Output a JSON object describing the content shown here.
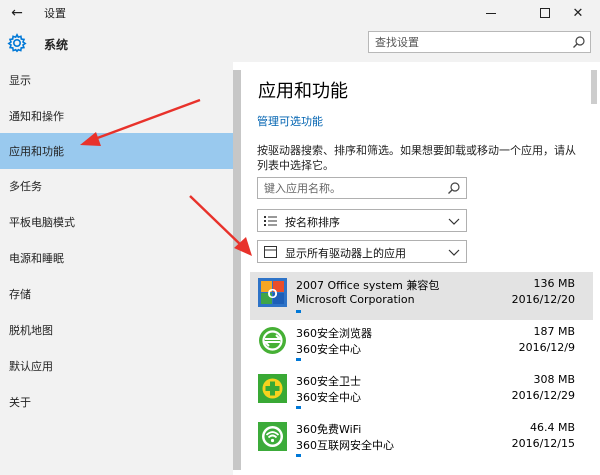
{
  "window": {
    "back_glyph": "←",
    "title": "设置",
    "minimize_icon": "minimize-icon",
    "maximize_icon": "maximize-icon",
    "close_glyph": "✕"
  },
  "header": {
    "section_title": "系统",
    "search_placeholder": "查找设置"
  },
  "sidebar": {
    "items": [
      {
        "label": "显示",
        "active": false
      },
      {
        "label": "通知和操作",
        "active": false
      },
      {
        "label": "应用和功能",
        "active": true
      },
      {
        "label": "多任务",
        "active": false
      },
      {
        "label": "平板电脑模式",
        "active": false
      },
      {
        "label": "电源和睡眠",
        "active": false
      },
      {
        "label": "存储",
        "active": false
      },
      {
        "label": "脱机地图",
        "active": false
      },
      {
        "label": "默认应用",
        "active": false
      },
      {
        "label": "关于",
        "active": false
      }
    ]
  },
  "main": {
    "title": "应用和功能",
    "manage_link": "管理可选功能",
    "description": "按驱动器搜索、排序和筛选。如果想要卸载或移动一个应用，请从列表中选择它。",
    "app_search_placeholder": "键入应用名称。",
    "sort_label": "按名称排序",
    "drive_filter_label": "显示所有驱动器上的应用",
    "apps": [
      {
        "name": "2007 Office system 兼容包",
        "publisher": "Microsoft Corporation",
        "size": "136 MB",
        "date": "2016/12/20",
        "icon": "office-compat-icon",
        "usage_fraction": 0.02,
        "selected": true
      },
      {
        "name": "360安全浏览器",
        "publisher": "360安全中心",
        "size": "187 MB",
        "date": "2016/12/9",
        "icon": "360-browser-icon",
        "usage_fraction": 0.02,
        "selected": false
      },
      {
        "name": "360安全卫士",
        "publisher": "360安全中心",
        "size": "308 MB",
        "date": "2016/12/29",
        "icon": "360-guard-icon",
        "usage_fraction": 0.02,
        "selected": false
      },
      {
        "name": "360免费WiFi",
        "publisher": "360互联网安全中心",
        "size": "46.4 MB",
        "date": "2016/12/15",
        "icon": "360-wifi-icon",
        "usage_fraction": 0.02,
        "selected": false
      }
    ]
  },
  "colors": {
    "accent": "#0078d7",
    "link": "#0063b1",
    "active_nav": "#99c9ee",
    "annotation": "#e8322b"
  }
}
